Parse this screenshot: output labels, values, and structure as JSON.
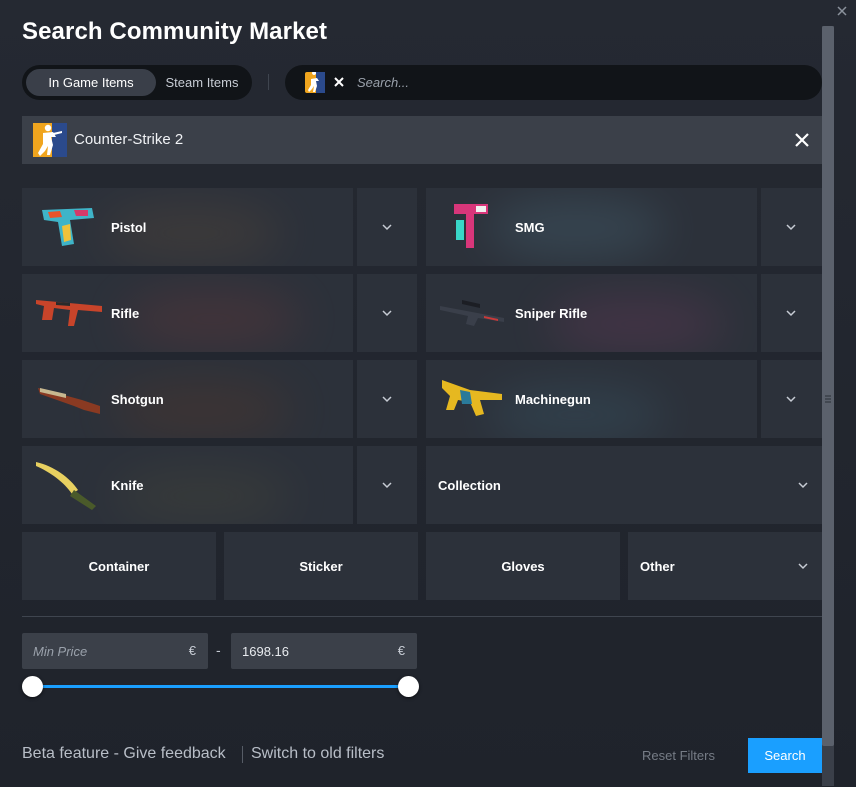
{
  "dialog": {
    "title": "Search Community Market"
  },
  "item_type": {
    "options": [
      "In Game Items",
      "Steam Items"
    ],
    "selected": "In Game Items"
  },
  "search": {
    "placeholder": "Search...",
    "value": "",
    "game_icon": "counter-strike-icon"
  },
  "game": {
    "name": "Counter-Strike 2",
    "logo": "counter-strike-logo"
  },
  "categories": [
    {
      "label": "Pistol",
      "image": "pistol-skin-image",
      "expandable": true
    },
    {
      "label": "SMG",
      "image": "smg-skin-image",
      "expandable": true
    },
    {
      "label": "Rifle",
      "image": "rifle-skin-image",
      "expandable": true
    },
    {
      "label": "Sniper Rifle",
      "image": "sniper-rifle-skin-image",
      "expandable": true
    },
    {
      "label": "Shotgun",
      "image": "shotgun-skin-image",
      "expandable": true
    },
    {
      "label": "Machinegun",
      "image": "machinegun-skin-image",
      "expandable": true
    },
    {
      "label": "Knife",
      "image": "knife-skin-image",
      "expandable": true
    },
    {
      "label": "Collection",
      "expandable": true
    },
    {
      "label": "Container",
      "expandable": false
    },
    {
      "label": "Sticker",
      "expandable": false
    },
    {
      "label": "Gloves",
      "expandable": false
    },
    {
      "label": "Other",
      "expandable": true
    }
  ],
  "price": {
    "min_placeholder": "Min Price",
    "min_value": "",
    "max_value": "1698.16",
    "currency": "€",
    "separator": "-",
    "slider_min_fraction": 0,
    "slider_max_fraction": 1
  },
  "footer": {
    "feedback_link": "Beta feature - Give feedback",
    "old_filters_link": "Switch to old filters",
    "reset_label": "Reset Filters",
    "search_label": "Search"
  },
  "colors": {
    "accent": "#1a9fff",
    "background": "#1f232b",
    "tile": "#2c313a",
    "game_bar": "#3b4049"
  }
}
